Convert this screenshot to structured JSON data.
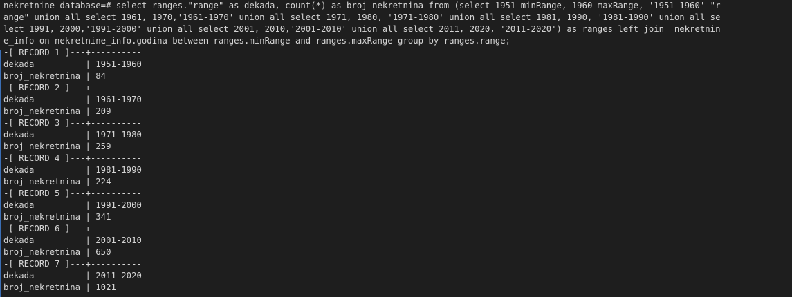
{
  "terminal": {
    "prompt": "nekretnine_database=#",
    "command_lines": [
      "nekretnine_database=# select ranges.\"range\" as dekada, count(*) as broj_nekretnina from (select 1951 minRange, 1960 maxRange, '1951-1960' \"r",
      "ange\" union all select 1961, 1970,'1961-1970' union all select 1971, 1980, '1971-1980' union all select 1981, 1990, '1981-1990' union all se",
      "lect 1991, 2000,'1991-2000' union all select 2001, 2010,'2001-2010' union all select 2011, 2020, '2011-2020') as ranges left join  nekretnin",
      "e_info on nekretnine_info.godina between ranges.minRange and ranges.maxRange group by ranges.range;"
    ],
    "records": [
      {
        "header": "-[ RECORD 1 ]---+----------",
        "dekada": "dekada          | 1951-1960",
        "broj": "broj_nekretnina | 84"
      },
      {
        "header": "-[ RECORD 2 ]---+----------",
        "dekada": "dekada          | 1961-1970",
        "broj": "broj_nekretnina | 209"
      },
      {
        "header": "-[ RECORD 3 ]---+----------",
        "dekada": "dekada          | 1971-1980",
        "broj": "broj_nekretnina | 259"
      },
      {
        "header": "-[ RECORD 4 ]---+----------",
        "dekada": "dekada          | 1981-1990",
        "broj": "broj_nekretnina | 224"
      },
      {
        "header": "-[ RECORD 5 ]---+----------",
        "dekada": "dekada          | 1991-2000",
        "broj": "broj_nekretnina | 341"
      },
      {
        "header": "-[ RECORD 6 ]---+----------",
        "dekada": "dekada          | 2001-2010",
        "broj": "broj_nekretnina | 650"
      },
      {
        "header": "-[ RECORD 7 ]---+----------",
        "dekada": "dekada          | 2011-2020",
        "broj": "broj_nekretnina | 1021"
      }
    ]
  },
  "colors": {
    "background": "#1e1e1e",
    "text": "#d4d4d4",
    "left_bar": "#3b6fb6"
  }
}
